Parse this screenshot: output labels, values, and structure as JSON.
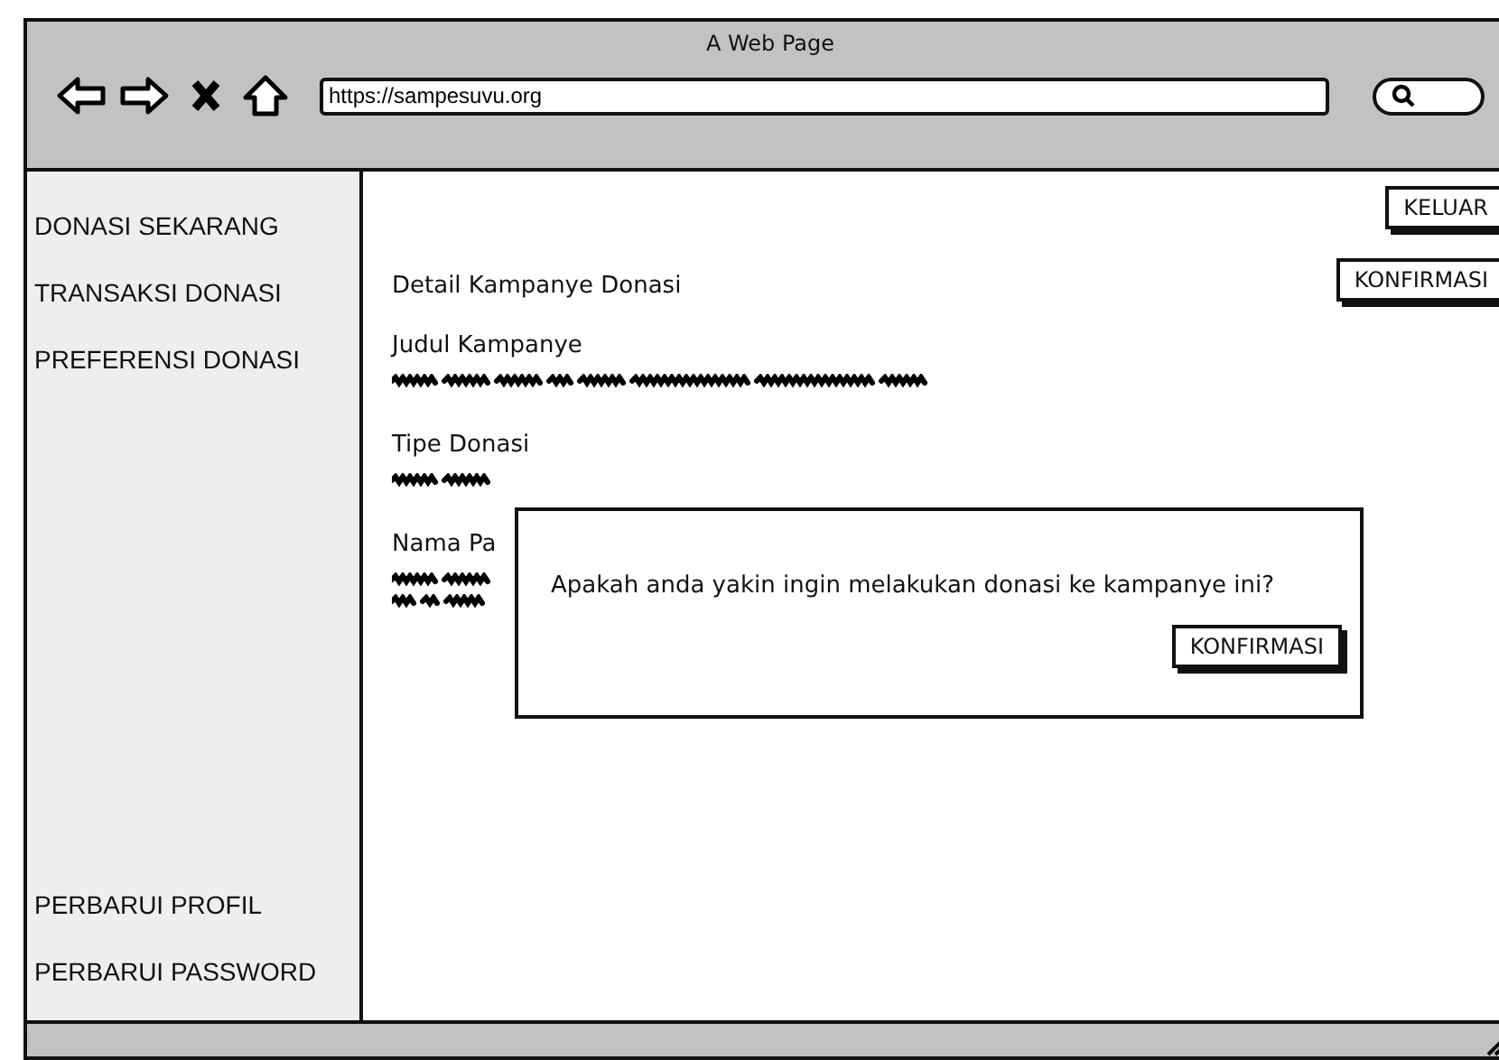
{
  "window": {
    "title": "A Web Page"
  },
  "browser": {
    "url": "https://sampesuvu.org",
    "nav": [
      {
        "kind": "back"
      },
      {
        "kind": "forward"
      },
      {
        "kind": "stop"
      },
      {
        "kind": "home"
      }
    ]
  },
  "sidebar": {
    "top_items": [
      "DONASI SEKARANG",
      "TRANSAKSI DONASI",
      "PREFERENSI DONASI"
    ],
    "bottom_items": [
      "PERBARUI PROFIL",
      "PERBARUI PASSWORD"
    ]
  },
  "header_buttons": [
    "KELUAR",
    "KONFIRMASI"
  ],
  "content": {
    "heading": "Detail Kampanye Donasi",
    "fields": [
      {
        "label": "Judul Kampanye",
        "kind": "scribble"
      },
      {
        "label": "Tipe Donasi",
        "kind": "scribble_cut"
      },
      {
        "label": "Nama Pa",
        "kind": "scribble2"
      }
    ]
  },
  "dialog": {
    "message": "Apakah anda yakin ingin melakukan donasi ke kampanye ini?",
    "button": "KONFIRMASI"
  }
}
